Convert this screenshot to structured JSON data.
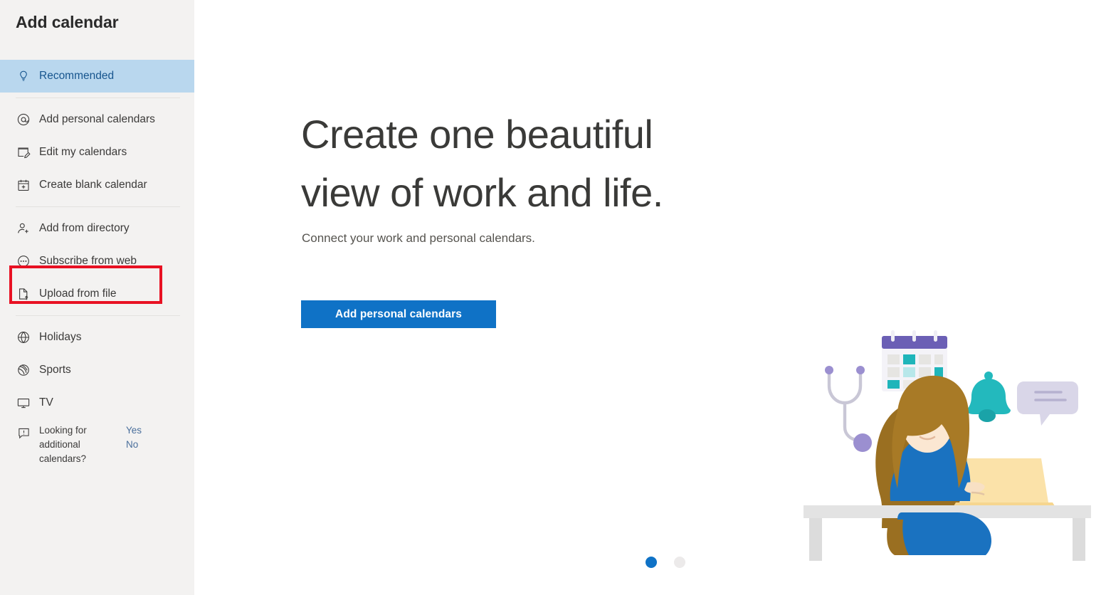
{
  "sidebar": {
    "title": "Add calendar",
    "items": [
      {
        "label": "Recommended",
        "icon": "lightbulb-icon",
        "selected": true
      },
      {
        "label": "Add personal calendars",
        "icon": "at-sign-icon",
        "selected": false
      },
      {
        "label": "Edit my calendars",
        "icon": "edit-calendar-icon",
        "selected": false
      },
      {
        "label": "Create blank calendar",
        "icon": "calendar-plus-icon",
        "selected": false
      },
      {
        "label": "Add from directory",
        "icon": "person-add-icon",
        "selected": false
      },
      {
        "label": "Subscribe from web",
        "icon": "circle-ellipsis-icon",
        "selected": false,
        "highlighted": true
      },
      {
        "label": "Upload from file",
        "icon": "file-upload-icon",
        "selected": false
      },
      {
        "label": "Holidays",
        "icon": "globe-icon",
        "selected": false
      },
      {
        "label": "Sports",
        "icon": "sports-ball-icon",
        "selected": false
      },
      {
        "label": "TV",
        "icon": "tv-monitor-icon",
        "selected": false
      }
    ],
    "feedback": {
      "icon": "feedback-bubble-icon",
      "question": "Looking for additional calendars?",
      "yes_label": "Yes",
      "no_label": "No"
    }
  },
  "main": {
    "hero_title": "Create one beautiful\nview of work and life.",
    "hero_subtitle": "Connect your work and personal calendars.",
    "cta_label": "Add personal calendars",
    "carousel": {
      "total": 2,
      "active_index": 0
    },
    "illustration_alt": "woman-at-laptop-illustration"
  },
  "colors": {
    "accent_blue": "#0f72c6",
    "selected_nav_bg": "#b9d7ee",
    "selected_nav_text": "#17558e",
    "sidebar_bg": "#f3f2f1",
    "highlight_red": "#e81123",
    "link_blue": "#4a6f9c"
  }
}
